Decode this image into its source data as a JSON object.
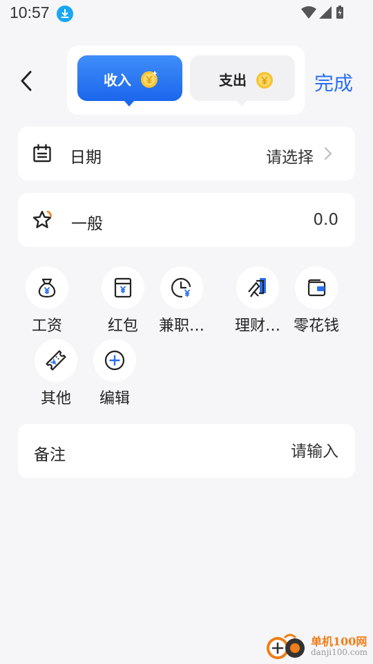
{
  "status_bar": {
    "time": "10:57"
  },
  "header": {
    "tabs": [
      {
        "label": "收入",
        "active": true
      },
      {
        "label": "支出",
        "active": false
      }
    ],
    "done_label": "完成"
  },
  "date_row": {
    "label": "日期",
    "value": "请选择"
  },
  "type_row": {
    "label": "一般",
    "amount": "0.0"
  },
  "categories": [
    {
      "name": "工资",
      "icon": "money-bag-icon"
    },
    {
      "name": "红包",
      "icon": "red-packet-icon"
    },
    {
      "name": "兼职…",
      "icon": "clock-yen-icon"
    },
    {
      "name": "理财…",
      "icon": "investment-icon"
    },
    {
      "name": "零花钱",
      "icon": "wallet-icon"
    },
    {
      "name": "其他",
      "icon": "ticket-icon"
    },
    {
      "name": "编辑",
      "icon": "plus-circle-icon"
    }
  ],
  "note_row": {
    "label": "备注",
    "placeholder": "请输入"
  },
  "watermark": {
    "main": "单机100网",
    "sub": "danji100.com"
  },
  "colors": {
    "accent": "#2a6ff3",
    "background": "#f6f6f8",
    "card": "#ffffff"
  }
}
